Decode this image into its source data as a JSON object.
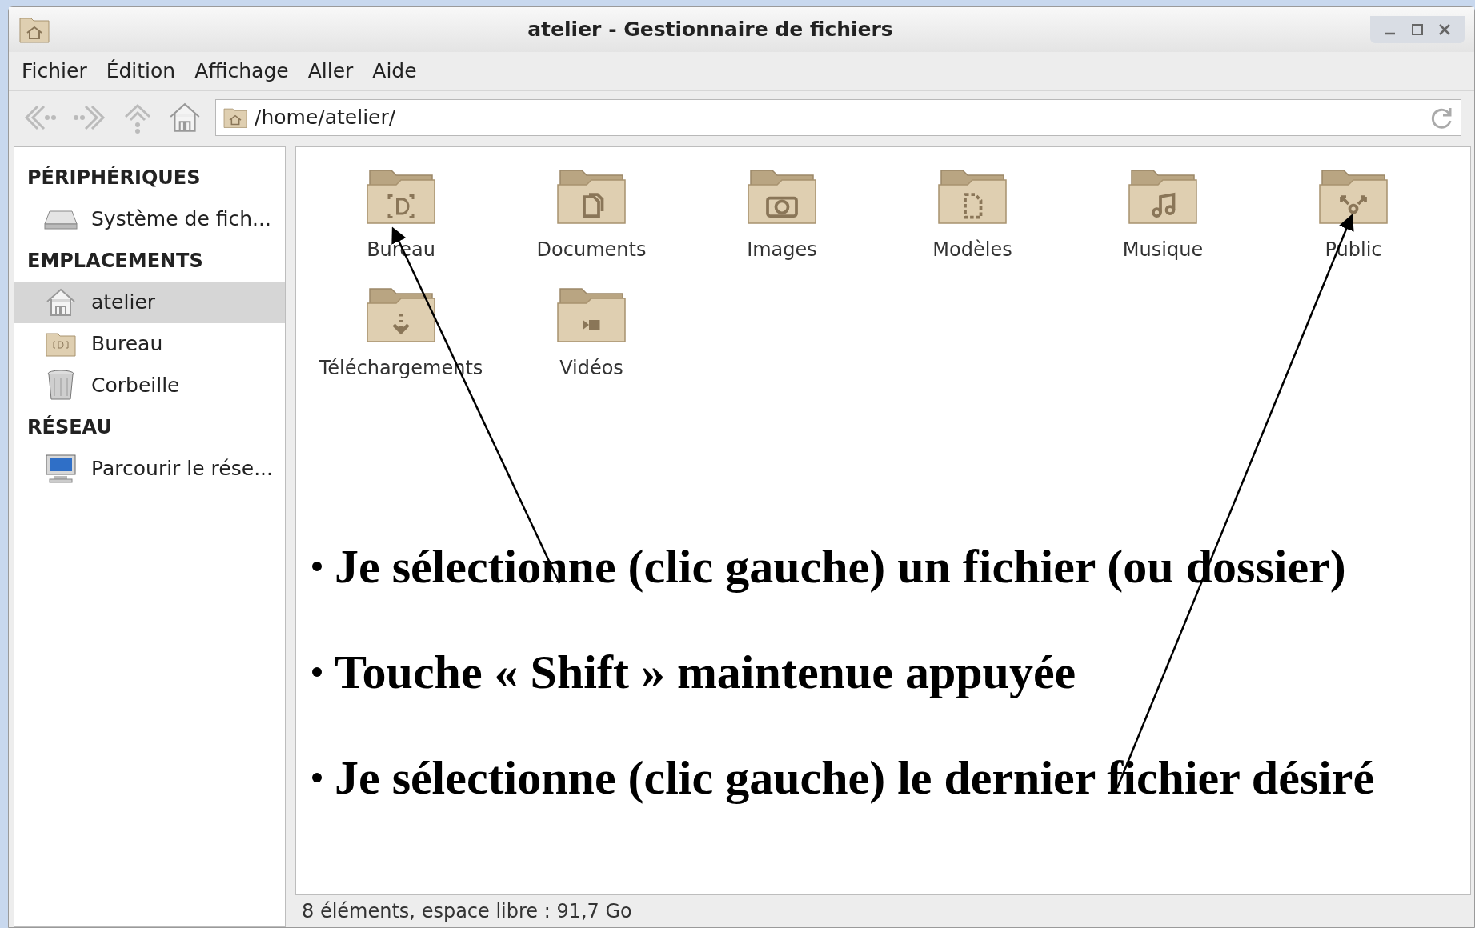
{
  "window": {
    "title": "atelier - Gestionnaire de fichiers"
  },
  "menu": [
    "Fichier",
    "Édition",
    "Affichage",
    "Aller",
    "Aide"
  ],
  "location": {
    "value": "/home/atelier/"
  },
  "sidebar": [
    {
      "heading": "PÉRIPHÉRIQUES",
      "items": [
        {
          "label": "Système de fich...",
          "kind": "drive",
          "selected": false
        }
      ]
    },
    {
      "heading": "EMPLACEMENTS",
      "items": [
        {
          "label": "atelier",
          "kind": "home",
          "selected": true
        },
        {
          "label": "Bureau",
          "kind": "folder",
          "selected": false
        },
        {
          "label": "Corbeille",
          "kind": "trash",
          "selected": false
        }
      ]
    },
    {
      "heading": "RÉSEAU",
      "items": [
        {
          "label": "Parcourir le rése...",
          "kind": "network",
          "selected": false
        }
      ]
    }
  ],
  "files": [
    {
      "name": "Bureau",
      "kind": "desktop"
    },
    {
      "name": "Documents",
      "kind": "documents"
    },
    {
      "name": "Images",
      "kind": "pictures"
    },
    {
      "name": "Modèles",
      "kind": "templates"
    },
    {
      "name": "Musique",
      "kind": "music"
    },
    {
      "name": "Public",
      "kind": "public"
    },
    {
      "name": "Téléchargements",
      "kind": "downloads"
    },
    {
      "name": "Vidéos",
      "kind": "videos"
    }
  ],
  "annotations": [
    "Je sélectionne (clic gauche) un fichier (ou dossier)",
    "Touche « Shift » maintenue appuyée",
    "Je sélectionne (clic gauche) le dernier fichier désiré"
  ],
  "status_bar": "8 éléments, espace libre : 91,7 Go"
}
